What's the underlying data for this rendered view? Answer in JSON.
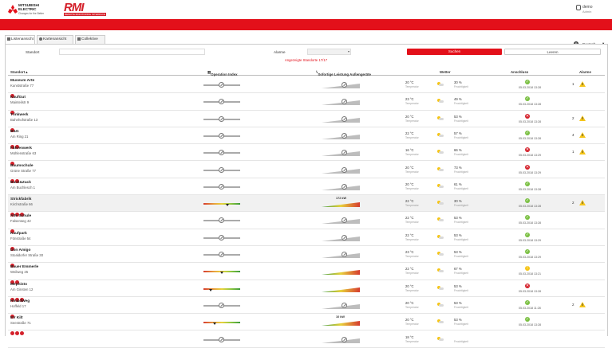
{
  "header": {
    "brand1_line1": "MITSUBISHI",
    "brand1_line2": "ELECTRIC",
    "brand1_tagline": "Changes for the Better",
    "brand2": "RMI",
    "brand2_sub": "REMOTE MONITORING INTERFACE",
    "user_name": "demo",
    "user_role": "Admin",
    "language": "Deutsch"
  },
  "tabs": [
    "Listenansicht",
    "Kartenansicht",
    "Collektive"
  ],
  "filters": {
    "standort_label": "Standort",
    "alarme_label": "Alarme",
    "search_label": "Suchen",
    "clear_label": "Leeren",
    "info": "Angezeigte Standorte 17/17"
  },
  "columns": {
    "standort": "Standort ▴",
    "operation_index": "Operation Index",
    "leistung": "Sofortige Leistung Außengeräte",
    "wetter": "Wetter",
    "anschluss": "Anschluss",
    "alarme": "Alarme"
  },
  "labels": {
    "temp": "Temperatur",
    "humidity": "Feuchtigkeit"
  },
  "sites": [
    {
      "name": "Museum Arte",
      "address": "Kunststraße 77",
      "icons": 1,
      "temp": "20 °C",
      "hum": "30 %",
      "status": "ok",
      "ts": "05.03.2018 13:28",
      "alarm": "1"
    },
    {
      "name": "KaufGut",
      "address": "Mainteilstr 9",
      "icons": 1,
      "temp": "23 °C",
      "hum": "49 %",
      "status": "ok",
      "ts": "05.03.2018 13:28",
      "alarm": ""
    },
    {
      "name": "Trinkwerk",
      "address": "Bahnhofstraße 13",
      "icons": 1,
      "temp": "20 °C",
      "hum": "53 %",
      "status": "err",
      "ts": "05.03.2018 13:28",
      "alarm": "2"
    },
    {
      "name": "B&G",
      "address": "Am Ring 21",
      "icons": 2,
      "temp": "22 °C",
      "hum": "57 %",
      "status": "ok",
      "ts": "05.03.2018 13:28",
      "alarm": "4"
    },
    {
      "name": "Fährenwerk",
      "address": "Mühlenstraße 63",
      "icons": 1,
      "temp": "16 °C",
      "hum": "66 %",
      "status": "err",
      "ts": "05.03.2018 13:29",
      "alarm": "1"
    },
    {
      "name": "Baumschule",
      "address": "Grüne Straße 77",
      "icons": 2,
      "temp": "20 °C",
      "hum": "73 %",
      "status": "err",
      "ts": "05.03.2018 13:29",
      "alarm": ""
    },
    {
      "name": "Back&Zack",
      "address": "Am Buchlesch 1",
      "icons": 1,
      "temp": "20 °C",
      "hum": "61 %",
      "status": "ok",
      "ts": "05.03.2018 13:28",
      "alarm": ""
    },
    {
      "name": "Strickfabrik",
      "address": "Kirchstraße 66",
      "icons": 3,
      "temp": "22 °C",
      "hum": "30 %",
      "status": "ok",
      "ts": "05.03.2018 13:28",
      "alarm": "2",
      "hl": true,
      "op": 0.65,
      "power": "172 kW"
    },
    {
      "name": "Alte Schule",
      "address": "Falserweg 42",
      "icons": 1,
      "temp": "22 °C",
      "hum": "53 %",
      "status": "ok",
      "ts": "05.03.2018 13:28",
      "alarm": ""
    },
    {
      "name": "Kaufpark",
      "address": "Fönstraße 54",
      "icons": 1,
      "temp": "22 °C",
      "hum": "53 %",
      "status": "ok",
      "ts": "05.03.2018 13:29",
      "alarm": ""
    },
    {
      "name": "Don Amigo",
      "address": "Stoaldorfer Straße 30",
      "icons": 1,
      "temp": "23 °C",
      "hum": "53 %",
      "status": "ok",
      "ts": "05.03.2018 13:29",
      "alarm": ""
    },
    {
      "name": "Bauer Emmerle",
      "address": "Weilweg 25",
      "icons": 2,
      "temp": "22 °C",
      "hum": "67 %",
      "status": "warn",
      "ts": "05.03.2018 13:21",
      "alarm": "",
      "op": 0.5,
      "power": ""
    },
    {
      "name": "Mephisto",
      "address": "Am Ginsten 12",
      "icons": 3,
      "temp": "20 °C",
      "hum": "53 %",
      "status": "err",
      "ts": "05.03.2018 13:28",
      "alarm": "",
      "op": 0.2,
      "power": ""
    },
    {
      "name": "Hin&dWeg",
      "address": "Hoffeld 17",
      "icons": 1,
      "temp": "20 °C",
      "hum": "53 %",
      "status": "ok",
      "ts": "05.03.2018 11:28",
      "alarm": "2"
    },
    {
      "name": "EV Kilt",
      "address": "Seestraße 71",
      "icons": 3,
      "temp": "20 °C",
      "hum": "53 %",
      "status": "ok",
      "ts": "05.03.2018 13:28",
      "alarm": "",
      "op": 0.3,
      "power": "10 kW"
    },
    {
      "name": "",
      "address": "",
      "icons": 0,
      "temp": "18 °C",
      "hum": "",
      "status": "",
      "ts": "",
      "alarm": ""
    }
  ]
}
